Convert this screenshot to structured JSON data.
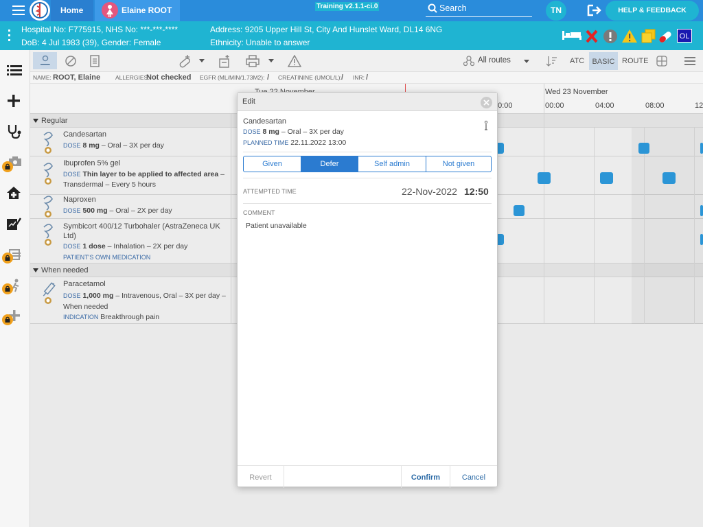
{
  "topbar": {
    "home_label": "Home",
    "patient_name": "Elaine ROOT",
    "version": "Training v2.1.1-ci.0",
    "search_label": "Search",
    "user_initials": "TN",
    "help_label": "HELP & FEEDBACK"
  },
  "patient": {
    "hospital_line": "Hospital No: F775915, NHS No: ***-***-****",
    "dob_line": "DoB: 4 Jul 1983 (39), Gender: Female",
    "address_line": "Address: 9205 Upper Hill St, City And Hunslet Ward, DL14 6NG",
    "ethnicity_line": "Ethnicity: Unable to answer",
    "ol_badge": "OL"
  },
  "toolbar": {
    "routes_label": "All routes",
    "atc_label": "ATC",
    "basic_label": "BASIC",
    "route_label": "ROUTE"
  },
  "infobar": {
    "name_label": "NAME:",
    "name_value": "ROOT, Elaine",
    "allergies_label": "ALLERGIES:",
    "allergies_value": "Not checked",
    "egfr_label": "EGFR (ML/MIN/1.73M2):",
    "egfr_value": "/",
    "creat_label": "CREATININE (UMOL/L):",
    "creat_value": "/",
    "inr_label": "INR:",
    "inr_value": "/"
  },
  "timeline": {
    "prev_day": "Tue 22 November",
    "next_day": "Wed 23 November",
    "times": [
      "20:00",
      "00:00",
      "04:00",
      "08:00",
      "12"
    ]
  },
  "sections": {
    "regular": "Regular",
    "when_needed": "When needed"
  },
  "drugs": [
    {
      "name": "Candesartan",
      "dose_label": "DOSE",
      "dose": "8 mg",
      "rest": "– Oral – 3X per day"
    },
    {
      "name": "Ibuprofen 5% gel",
      "dose_label": "DOSE",
      "dose": "Thin layer to be applied to affected area",
      "rest": "– Transdermal – Every 5 hours"
    },
    {
      "name": "Naproxen",
      "dose_label": "DOSE",
      "dose": "500 mg",
      "rest": "– Oral – 2X per day"
    },
    {
      "name": "Symbicort 400/12 Turbohaler (AstraZeneca UK Ltd)",
      "dose_label": "DOSE",
      "dose": "1 dose",
      "rest": "– Inhalation – 2X per day",
      "extra": "PATIENT'S OWN MEDICATION"
    },
    {
      "name": "Paracetamol",
      "dose_label": "DOSE",
      "dose": "1,000 mg",
      "rest": "– Intravenous, Oral – 3X per day – When needed",
      "ind_label": "INDICATION",
      "ind": "Breakthrough pain"
    }
  ],
  "modal": {
    "title": "Edit",
    "drug_name": "Candesartan",
    "dose_label": "DOSE",
    "dose": "8 mg",
    "dose_rest": "– Oral – 3X per day",
    "planned_label": "PLANNED TIME",
    "planned_value": "22.11.2022 13:00",
    "tabs": [
      "Given",
      "Defer",
      "Self admin",
      "Not given"
    ],
    "active_tab": "Defer",
    "attempted_label": "ATTEMPTED TIME",
    "attempted_date": "22-Nov-2022",
    "attempted_time": "12:50",
    "comment_label": "COMMENT",
    "comment_value": "Patient unavailable",
    "revert_label": "Revert",
    "confirm_label": "Confirm",
    "cancel_label": "Cancel"
  },
  "colors": {
    "topbar": "#2a8cdb",
    "patbar": "#1fb4d2",
    "accent": "#2b7bd0",
    "tick": "#2b95d6",
    "lock": "#f0a01c"
  }
}
